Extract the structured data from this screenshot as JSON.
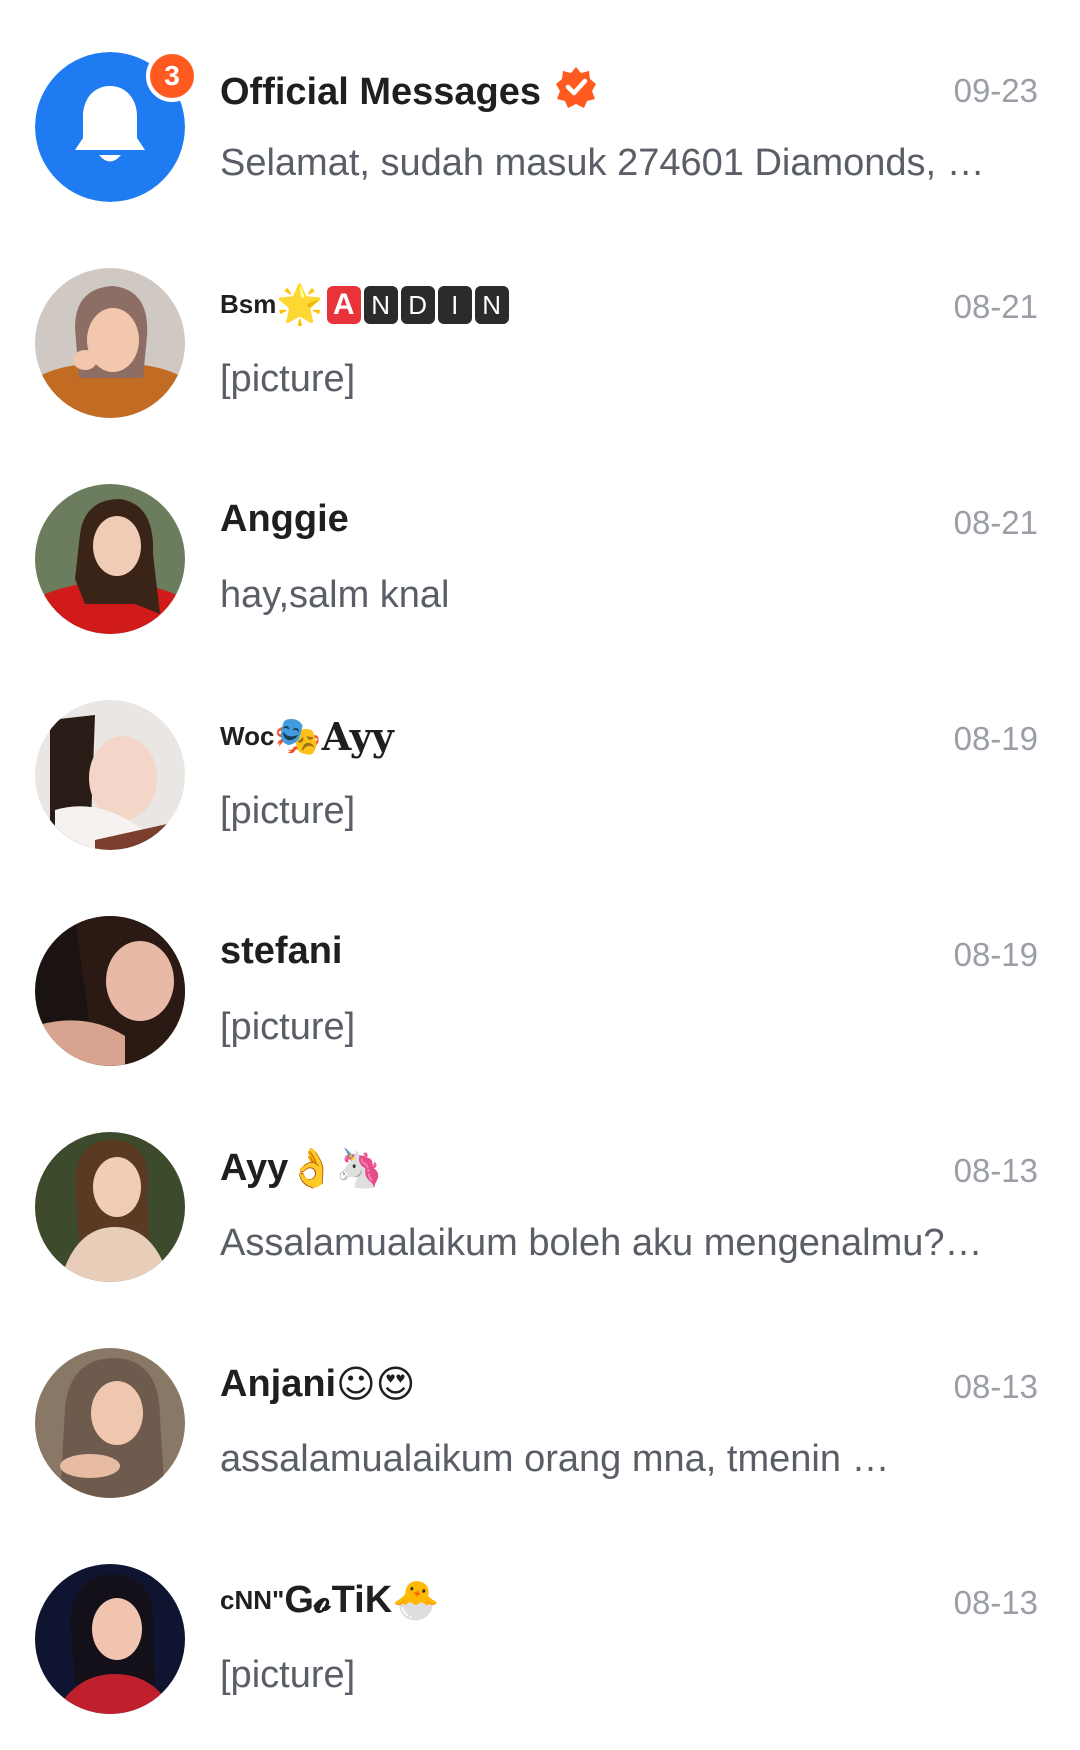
{
  "conversations": [
    {
      "name": "Official Messages",
      "date": "09-23",
      "preview": "Selamat, sudah masuk 274601 Diamonds, …",
      "badge": "3",
      "verified": true,
      "avatar_icon": "bell-icon",
      "avatar_color": "#1e7bf2"
    },
    {
      "name_prefix": "Bsm",
      "name_emoji": "🌟",
      "name_letters": [
        "A",
        "N",
        "D",
        "I",
        "N"
      ],
      "date": "08-21",
      "preview": "[picture]"
    },
    {
      "name": "Anggie",
      "date": "08-21",
      "preview": "hay,salm knal"
    },
    {
      "name_prefix": "Woc",
      "name_emoji": "🎭",
      "name_suffix": "Ayy",
      "date": "08-19",
      "preview": "[picture]"
    },
    {
      "name": "stefani",
      "date": "08-19",
      "preview": "[picture]"
    },
    {
      "name": "Ayy",
      "name_emoji": "👌🦄",
      "date": "08-13",
      "preview": "Assalamualaikum boleh aku mengenalmu?…"
    },
    {
      "name": "Anjani",
      "name_emoji": "☺😍",
      "date": "08-13",
      "preview": "assalamualaikum orang mna, tmenin …"
    },
    {
      "name_prefix": "cNN\"",
      "name_suffix": "G𝓸TiK",
      "name_emoji": "🐣",
      "date": "08-13",
      "preview": "[picture]"
    }
  ],
  "colors": {
    "accent_orange": "#ff5a1f",
    "bell_blue": "#1e7bf2",
    "date_gray": "#9a9ea6",
    "preview_gray": "#5a5e66"
  }
}
